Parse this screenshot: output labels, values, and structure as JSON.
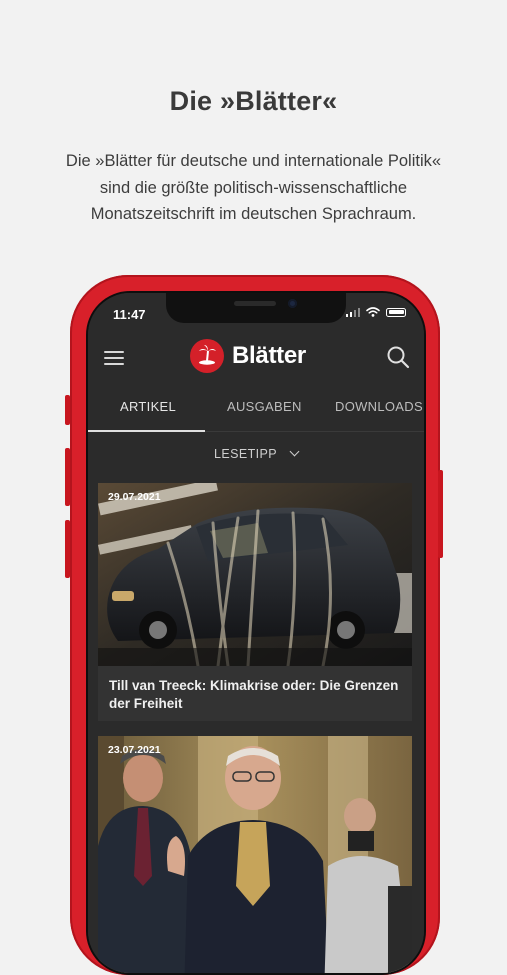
{
  "promo": {
    "title": "Die »Blätter«",
    "lines": [
      "Die »Blätter für deutsche und internationale Politik«",
      "sind die größte politisch-wissenschaftliche",
      "Monatszeitschrift im deutschen Sprachraum."
    ]
  },
  "status": {
    "time": "11:47"
  },
  "header": {
    "logo_text": "Blätter",
    "logo_icon": "palm-island-icon",
    "menu_icon": "hamburger-icon",
    "search_icon": "search-icon"
  },
  "tabs": [
    {
      "label": "ARTIKEL",
      "active": true
    },
    {
      "label": "AUSGABEN",
      "active": false
    },
    {
      "label": "DOWNLOADS",
      "active": false
    }
  ],
  "filter": {
    "label": "LESETIPP"
  },
  "articles": [
    {
      "date": "29.07.2021",
      "title": "Till van Treeck: Klimakrise oder: Die Grenzen der Freiheit"
    },
    {
      "date": "23.07.2021",
      "title": ""
    }
  ],
  "colors": {
    "accent": "#d8202a",
    "background": "#2b2b2b",
    "page": "#f2f2f2"
  }
}
